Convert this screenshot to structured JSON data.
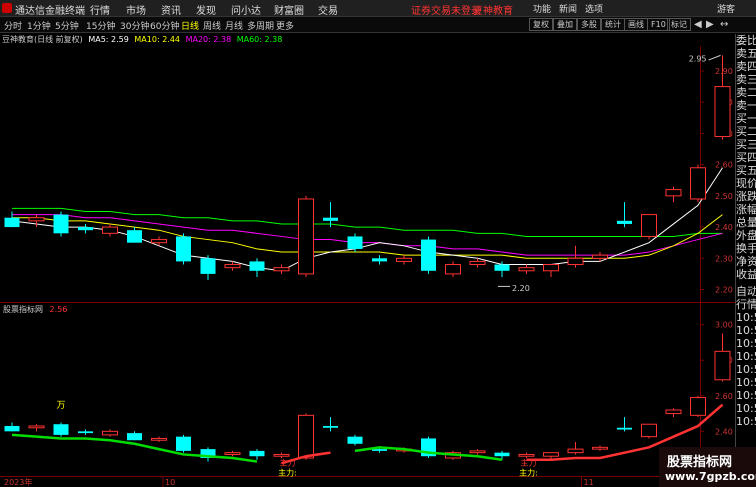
{
  "menubar": {
    "app_title": "通达信金融终端",
    "items": [
      "行情",
      "市场",
      "资讯",
      "发现",
      "问小达",
      "财富圈",
      "交易"
    ],
    "login_notice": "证券交易未登录",
    "brand": "豆神教育",
    "right_items": [
      "功能",
      "新闻",
      "选项"
    ],
    "guest": "游客"
  },
  "toolbar": {
    "periods": [
      "分时",
      "1分钟",
      "5分钟",
      "15分钟",
      "30分钟",
      "60分钟",
      "日线",
      "周线",
      "月线",
      "多周期",
      "更多"
    ],
    "active_period": "日线",
    "buttons": [
      "复权",
      "叠加",
      "多股",
      "统计",
      "画线",
      "F10",
      "标记"
    ]
  },
  "main_header": {
    "stock": "豆神教育(日线 前复权)",
    "ma5": "MA5: 2.59",
    "ma10": "MA10: 2.44",
    "ma20": "MA20: 2.38",
    "ma60": "MA60: 2.38"
  },
  "indicator_header": {
    "name": "股票指标网",
    "value": "2.56"
  },
  "price_axis_main": [
    "2.90",
    "2.80",
    "2.70",
    "2.60",
    "2.50",
    "2.40",
    "2.30",
    "2.20"
  ],
  "price_axis_ind": [
    "3.00",
    "2.80",
    "2.60",
    "2.40"
  ],
  "annotations": {
    "high": "2.95",
    "low": "2.20",
    "wan": "万",
    "zhuli": "主力",
    "zhuli_colon": "主力:"
  },
  "date_axis": [
    "2023年",
    "10",
    "11"
  ],
  "sidepanel": [
    "委比",
    "卖五",
    "卖四",
    "卖三",
    "卖二",
    "卖一",
    "买一",
    "买二",
    "买三",
    "买四",
    "买五",
    "现价",
    "涨跌",
    "涨幅",
    "总量",
    "外盘",
    "换手",
    "净资",
    "收益",
    "自动",
    "行情",
    "10:5",
    "10:5",
    "10:5",
    "10:5",
    "10:5",
    "10:5",
    "10:5",
    "10:5",
    "10:5"
  ],
  "watermark": {
    "line1": "股票指标网",
    "line2": "www.7gpzb.com"
  },
  "colors": {
    "up": "#ff3333",
    "down": "#00ffff",
    "ma5": "#ffffff",
    "ma10": "#ffff00",
    "ma20": "#ff00ff",
    "ma60": "#00ff00",
    "label_red": "#ff3333",
    "label_yellow": "#ffff00"
  },
  "chart_data": {
    "type": "candlestick",
    "candles": [
      {
        "o": 2.43,
        "h": 2.45,
        "l": 2.4,
        "c": 2.4,
        "dir": "down"
      },
      {
        "o": 2.42,
        "h": 2.44,
        "l": 2.4,
        "c": 2.43,
        "dir": "up"
      },
      {
        "o": 2.44,
        "h": 2.45,
        "l": 2.37,
        "c": 2.38,
        "dir": "down"
      },
      {
        "o": 2.39,
        "h": 2.41,
        "l": 2.38,
        "c": 2.4,
        "dir": "down"
      },
      {
        "o": 2.4,
        "h": 2.41,
        "l": 2.37,
        "c": 2.38,
        "dir": "up"
      },
      {
        "o": 2.39,
        "h": 2.4,
        "l": 2.35,
        "c": 2.35,
        "dir": "down"
      },
      {
        "o": 2.35,
        "h": 2.37,
        "l": 2.34,
        "c": 2.36,
        "dir": "up"
      },
      {
        "o": 2.37,
        "h": 2.38,
        "l": 2.28,
        "c": 2.29,
        "dir": "down"
      },
      {
        "o": 2.3,
        "h": 2.31,
        "l": 2.23,
        "c": 2.25,
        "dir": "down"
      },
      {
        "o": 2.27,
        "h": 2.29,
        "l": 2.26,
        "c": 2.28,
        "dir": "up"
      },
      {
        "o": 2.29,
        "h": 2.3,
        "l": 2.24,
        "c": 2.26,
        "dir": "down"
      },
      {
        "o": 2.26,
        "h": 2.28,
        "l": 2.25,
        "c": 2.27,
        "dir": "up"
      },
      {
        "o": 2.25,
        "h": 2.5,
        "l": 2.24,
        "c": 2.49,
        "dir": "up"
      },
      {
        "o": 2.43,
        "h": 2.48,
        "l": 2.4,
        "c": 2.42,
        "dir": "down"
      },
      {
        "o": 2.37,
        "h": 2.38,
        "l": 2.32,
        "c": 2.33,
        "dir": "down"
      },
      {
        "o": 2.3,
        "h": 2.31,
        "l": 2.28,
        "c": 2.29,
        "dir": "down"
      },
      {
        "o": 2.29,
        "h": 2.31,
        "l": 2.28,
        "c": 2.3,
        "dir": "up"
      },
      {
        "o": 2.36,
        "h": 2.37,
        "l": 2.25,
        "c": 2.26,
        "dir": "down"
      },
      {
        "o": 2.25,
        "h": 2.29,
        "l": 2.24,
        "c": 2.28,
        "dir": "up"
      },
      {
        "o": 2.28,
        "h": 2.3,
        "l": 2.27,
        "c": 2.29,
        "dir": "up"
      },
      {
        "o": 2.28,
        "h": 2.29,
        "l": 2.24,
        "c": 2.26,
        "dir": "down"
      },
      {
        "o": 2.26,
        "h": 2.28,
        "l": 2.25,
        "c": 2.27,
        "dir": "up"
      },
      {
        "o": 2.26,
        "h": 2.28,
        "l": 2.24,
        "c": 2.28,
        "dir": "up"
      },
      {
        "o": 2.28,
        "h": 2.34,
        "l": 2.27,
        "c": 2.3,
        "dir": "up"
      },
      {
        "o": 2.3,
        "h": 2.32,
        "l": 2.29,
        "c": 2.31,
        "dir": "up"
      },
      {
        "o": 2.42,
        "h": 2.48,
        "l": 2.4,
        "c": 2.41,
        "dir": "down"
      },
      {
        "o": 2.37,
        "h": 2.44,
        "l": 2.36,
        "c": 2.44,
        "dir": "up"
      },
      {
        "o": 2.5,
        "h": 2.53,
        "l": 2.48,
        "c": 2.52,
        "dir": "up"
      },
      {
        "o": 2.49,
        "h": 2.6,
        "l": 2.48,
        "c": 2.59,
        "dir": "up"
      },
      {
        "o": 2.69,
        "h": 2.95,
        "l": 2.68,
        "c": 2.85,
        "dir": "up"
      }
    ],
    "ma5": [
      2.42,
      2.41,
      2.4,
      2.4,
      2.39,
      2.37,
      2.34,
      2.31,
      2.3,
      2.29,
      2.27,
      2.26,
      2.3,
      2.32,
      2.33,
      2.35,
      2.34,
      2.32,
      2.31,
      2.3,
      2.28,
      2.28,
      2.28,
      2.29,
      2.29,
      2.32,
      2.35,
      2.41,
      2.47,
      2.59
    ],
    "ma10": [
      2.43,
      2.43,
      2.42,
      2.42,
      2.41,
      2.4,
      2.39,
      2.37,
      2.36,
      2.35,
      2.33,
      2.32,
      2.32,
      2.32,
      2.32,
      2.32,
      2.31,
      2.31,
      2.31,
      2.31,
      2.31,
      2.3,
      2.3,
      2.3,
      2.3,
      2.3,
      2.31,
      2.34,
      2.38,
      2.44
    ],
    "ma20": [
      2.44,
      2.44,
      2.44,
      2.43,
      2.43,
      2.42,
      2.41,
      2.4,
      2.39,
      2.39,
      2.38,
      2.37,
      2.36,
      2.36,
      2.35,
      2.35,
      2.34,
      2.34,
      2.33,
      2.33,
      2.32,
      2.31,
      2.31,
      2.31,
      2.31,
      2.31,
      2.32,
      2.34,
      2.36,
      2.38
    ],
    "ma60": [
      2.46,
      2.46,
      2.46,
      2.45,
      2.45,
      2.44,
      2.44,
      2.43,
      2.43,
      2.42,
      2.42,
      2.41,
      2.41,
      2.41,
      2.4,
      2.4,
      2.39,
      2.39,
      2.39,
      2.38,
      2.38,
      2.37,
      2.37,
      2.37,
      2.37,
      2.37,
      2.37,
      2.37,
      2.38,
      2.38
    ],
    "ylim": [
      2.16,
      2.98
    ],
    "ind_ylim": [
      2.16,
      3.06
    ]
  }
}
